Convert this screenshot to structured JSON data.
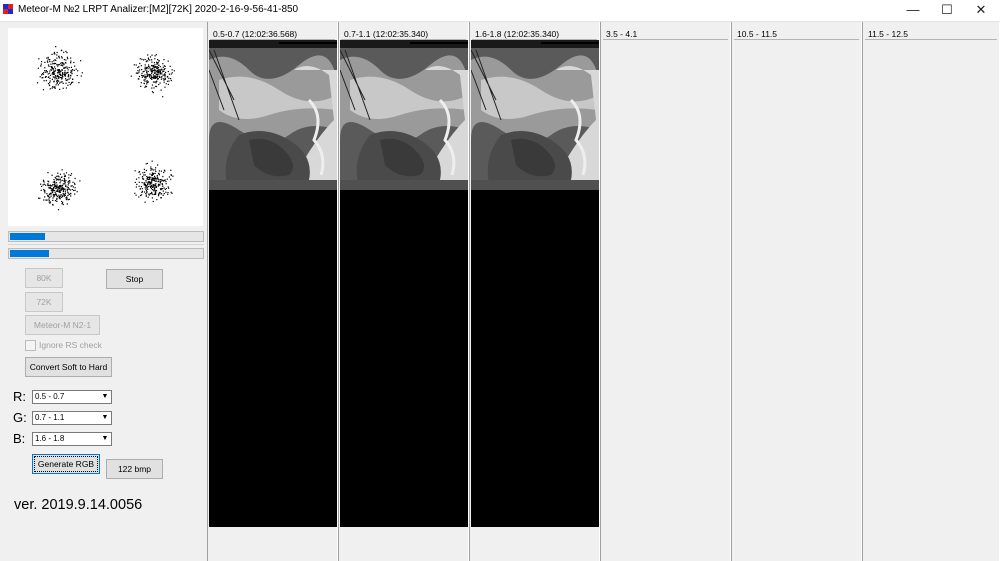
{
  "window": {
    "title": "Meteor-M №2 LRPT Analizer:[M2][72K] 2020-2-16-9-56-41-850",
    "app_icon": "meteor-app-icon",
    "minimize_glyph": "—",
    "maximize_glyph": "☐",
    "close_glyph": "✕"
  },
  "controls": {
    "progress_1_fraction": 0.18,
    "progress_2_fraction": 0.2,
    "btn_80k": "80K",
    "btn_stop": "Stop",
    "btn_72k": "72K",
    "btn_meteor": "Meteor-M N2-1",
    "ignore_rs_check": "Ignore RS check",
    "btn_convert": "Convert Soft to Hard",
    "r_label": "R:",
    "g_label": "G:",
    "b_label": "B:",
    "r_value": "0.5 - 0.7",
    "g_value": "0.7 - 1.1",
    "b_value": "1.6 - 1.8",
    "btn_generate_rgb": "Generate RGB",
    "btn_122bmp": "122 bmp",
    "version": "ver. 2019.9.14.0056"
  },
  "channels": [
    {
      "label": "0.5-0.7 (12:02:36.568)",
      "has_image": true
    },
    {
      "label": "0.7-1.1 (12:02:35.340)",
      "has_image": true
    },
    {
      "label": "1.6-1.8 (12:02:35.340)",
      "has_image": true
    },
    {
      "label": "3.5 - 4.1",
      "has_image": false
    },
    {
      "label": "10.5 - 11.5",
      "has_image": false
    },
    {
      "label": "11.5 - 12.5",
      "has_image": false
    }
  ],
  "colors": {
    "accent": "#0078d7",
    "image_background": "#000000"
  }
}
